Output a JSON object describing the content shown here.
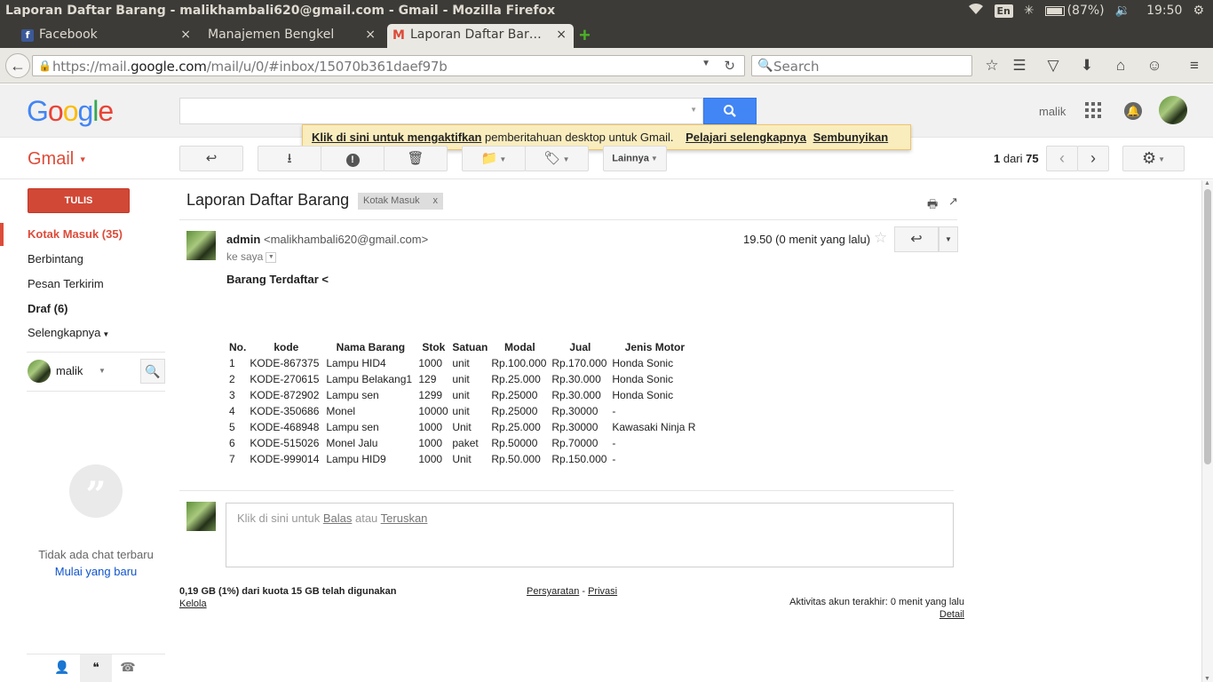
{
  "window": {
    "title": "Laporan Daftar Barang - malikhambali620@gmail.com - Gmail - Mozilla Firefox",
    "lang": "En",
    "battery": "(87%)",
    "clock": "19:50"
  },
  "tabs": [
    {
      "label": "Facebook",
      "close": "×"
    },
    {
      "label": "Manajemen Bengkel",
      "close": "×"
    },
    {
      "label": "Laporan Daftar Bar…",
      "close": "×"
    }
  ],
  "browser": {
    "url_prefix": "https://mail.",
    "url_domain": "google.com",
    "url_rest": "/mail/u/0/#inbox/15070b361daef97b",
    "search_placeholder": "Search"
  },
  "gmail": {
    "logo": "Google",
    "user": "malik",
    "notice": {
      "enable_link": "Klik di sini untuk mengaktifkan",
      "text": " pemberitahuan desktop untuk Gmail.",
      "learn_link": "Pelajari selengkapnya",
      "hide_link": "Sembunyikan"
    },
    "label": "Gmail",
    "more_button": "Lainnya",
    "counter": {
      "current": "1",
      "of": " dari ",
      "total": "75"
    }
  },
  "nav": {
    "compose": "TULIS",
    "items": [
      {
        "label": "Kotak Masuk (35)"
      },
      {
        "label": "Berbintang"
      },
      {
        "label": "Pesan Terkirim"
      },
      {
        "label": "Draf (6)"
      },
      {
        "label": "Selengkapnya"
      }
    ],
    "hangout_user": "malik",
    "no_chat": "Tidak ada chat terbaru",
    "new_chat": "Mulai yang baru"
  },
  "message": {
    "subject": "Laporan Daftar Barang",
    "label_chip": "Kotak Masuk",
    "label_chip_close": "x",
    "sender": "admin",
    "sender_email": "<malikhambali620@gmail.com>",
    "to": "ke saya",
    "time": "19.50 (0 menit yang lalu)",
    "heading": "Barang Terdaftar <",
    "table": {
      "headers": [
        "No.",
        "kode",
        "Nama Barang",
        "Stok",
        "Satuan",
        "Modal",
        "Jual",
        "Jenis Motor"
      ],
      "rows": [
        [
          "1",
          "KODE-867375",
          "Lampu HID4",
          "1000",
          "unit",
          "Rp.100.000",
          "Rp.170.000",
          "Honda Sonic"
        ],
        [
          "2",
          "KODE-270615",
          "Lampu Belakang1",
          "129",
          "unit",
          "Rp.25.000",
          "Rp.30.000",
          "Honda Sonic"
        ],
        [
          "3",
          "KODE-872902",
          "Lampu sen",
          "1299",
          "unit",
          "Rp.25000",
          "Rp.30.000",
          "Honda Sonic"
        ],
        [
          "4",
          "KODE-350686",
          "Monel",
          "10000",
          "unit",
          "Rp.25000",
          "Rp.30000",
          "-"
        ],
        [
          "5",
          "KODE-468948",
          "Lampu sen",
          "1000",
          "Unit",
          "Rp.25.000",
          "Rp.30000",
          "Kawasaki Ninja R"
        ],
        [
          "6",
          "KODE-515026",
          "Monel Jalu",
          "1000",
          "paket",
          "Rp.50000",
          "Rp.70000",
          "-"
        ],
        [
          "7",
          "KODE-999014",
          "Lampu HID9",
          "1000",
          "Unit",
          "Rp.50.000",
          "Rp.150.000",
          "-"
        ]
      ]
    },
    "reply_prompt": {
      "before": "Klik di sini untuk ",
      "reply": "Balas",
      "middle": " atau ",
      "forward": "Teruskan"
    }
  },
  "footer": {
    "quota": "0,19 GB (1%) dari kuota 15 GB telah digunakan",
    "manage": "Kelola",
    "terms": "Persyaratan",
    "sep": " - ",
    "privacy": "Privasi",
    "activity": "Aktivitas akun terakhir: 0 menit yang lalu",
    "detail": "Detail"
  },
  "colors": {
    "accent_red": "#dd4b39",
    "compose_red": "#d14836",
    "search_blue": "#4285f4",
    "link_blue": "#1155cc",
    "notice_bg": "#f9edbe"
  }
}
